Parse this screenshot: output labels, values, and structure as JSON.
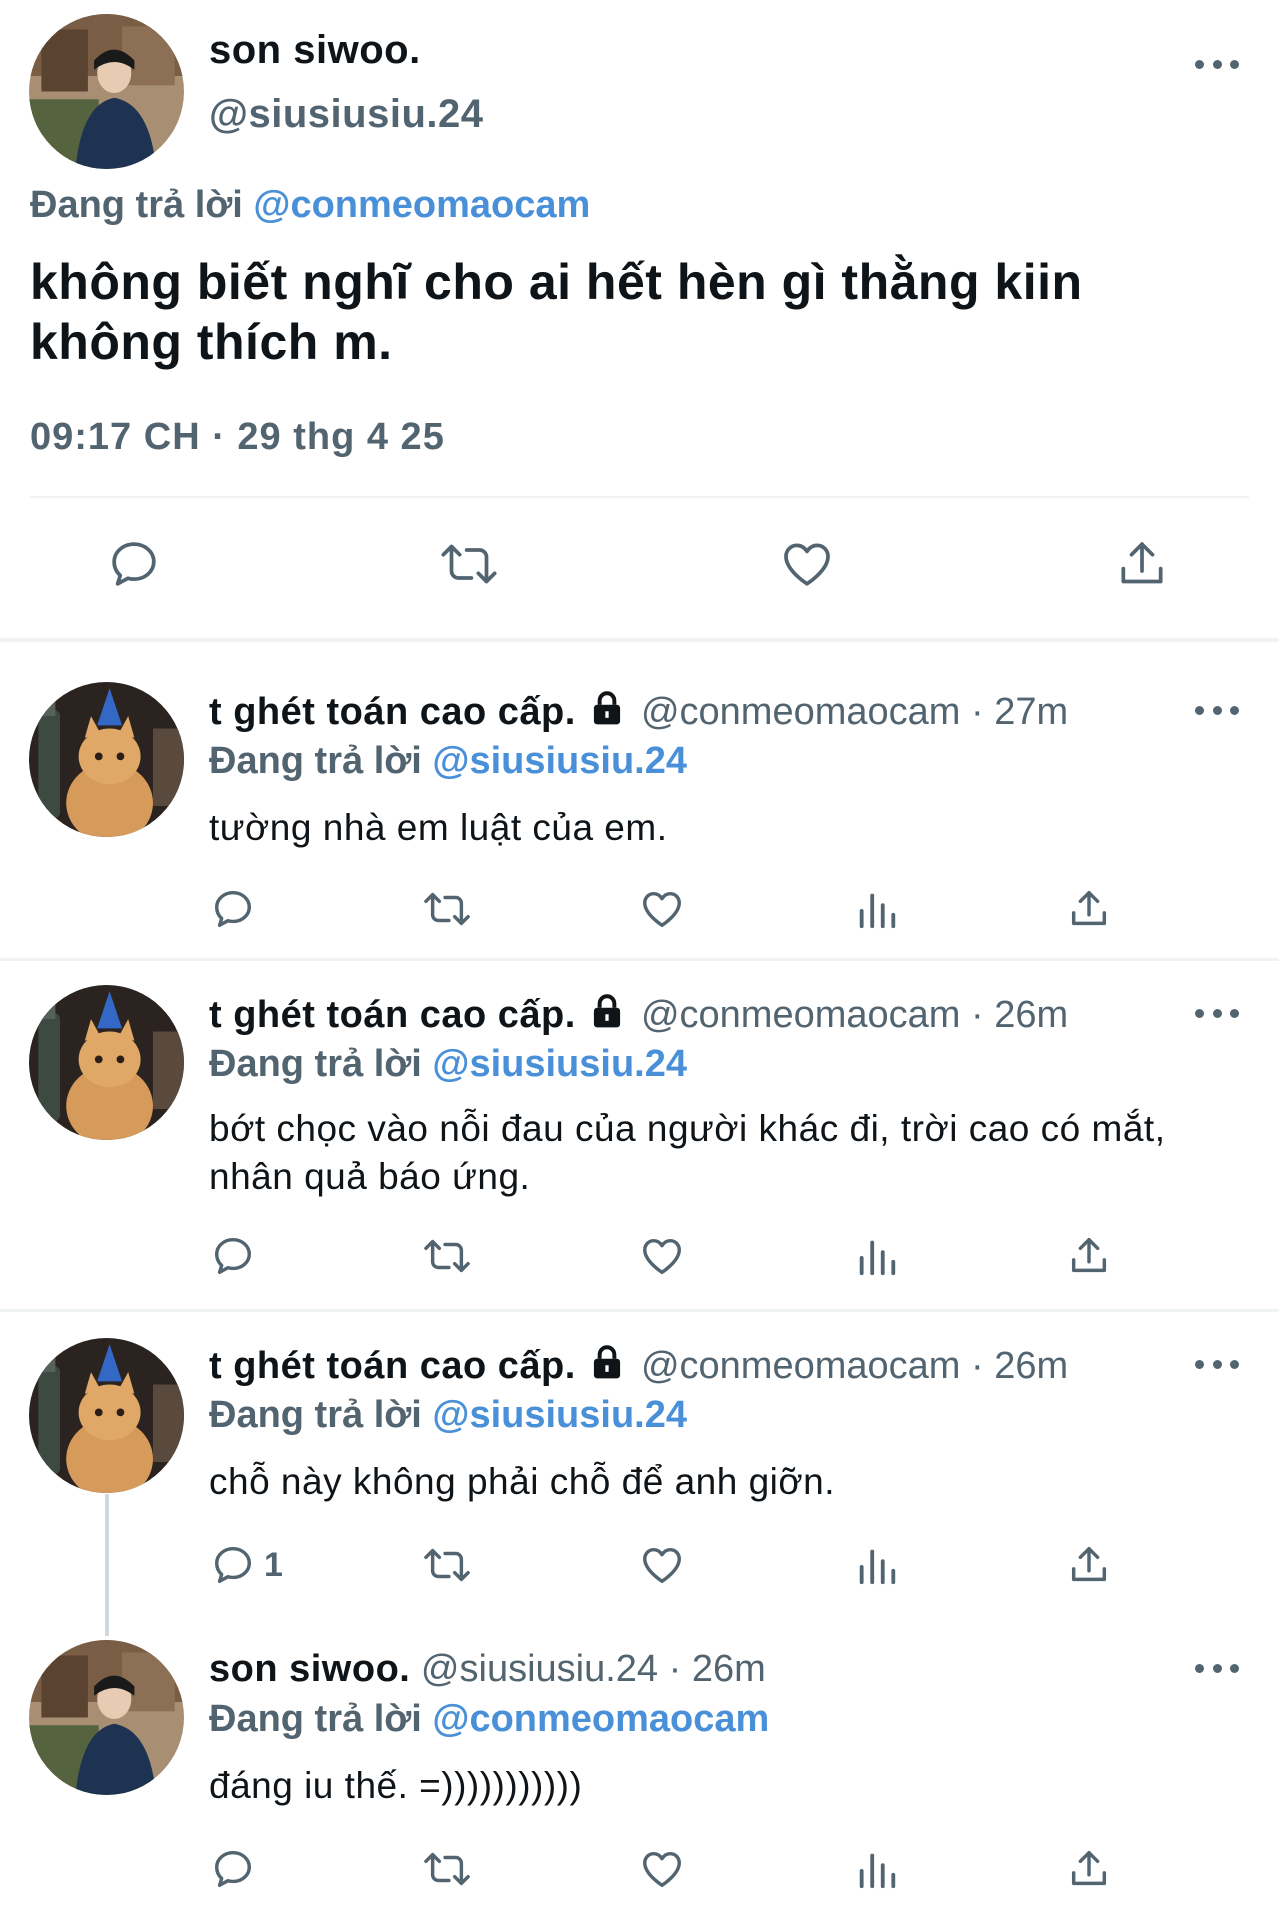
{
  "main": {
    "name": "son siwoo.",
    "handle": "@siusiusiu.24",
    "replying_prefix": "Đang trả lời",
    "replying_to": "@conmeomaocam",
    "text_line1": "không biết nghĩ cho ai hết hèn gì thằng kiin",
    "text_line2": "không thích m.",
    "timestamp": "09:17 CH · 29 thg 4 25"
  },
  "replies": [
    {
      "name": "t ghét toán cao cấp.",
      "meta": "@conmeomaocam · 27m",
      "replying_prefix": "Đang trả lời",
      "replying_to": "@siusiusiu.24",
      "text": "tường nhà em luật của em.",
      "reply_count": ""
    },
    {
      "name": "t ghét toán cao cấp.",
      "meta": "@conmeomaocam · 26m",
      "replying_prefix": "Đang trả lời",
      "replying_to": "@siusiusiu.24",
      "text": "bớt chọc vào nỗi đau của người khác đi, trời cao có mắt, nhân quả báo ứng.",
      "reply_count": ""
    },
    {
      "name": "t ghét toán cao cấp.",
      "meta": "@conmeomaocam · 26m",
      "replying_prefix": "Đang trả lời",
      "replying_to": "@siusiusiu.24",
      "text": "chỗ này không phải chỗ để anh giỡn.",
      "reply_count": "1"
    },
    {
      "name": "son siwoo.",
      "meta": "@siusiusiu.24 · 26m",
      "replying_prefix": "Đang trả lời",
      "replying_to": "@conmeomaocam",
      "text": "đáng iu thế. =)))))))))))",
      "reply_count": ""
    }
  ],
  "icons": {
    "reply": "reply-icon",
    "retweet": "retweet-icon",
    "like": "heart-icon",
    "views": "views-icon",
    "share": "share-icon",
    "more": "more-icon",
    "lock": "lock-icon"
  },
  "colors": {
    "text": "#0f1419",
    "secondary": "#536471",
    "mention": "#4a90d9",
    "divider": "#eff3f4"
  }
}
